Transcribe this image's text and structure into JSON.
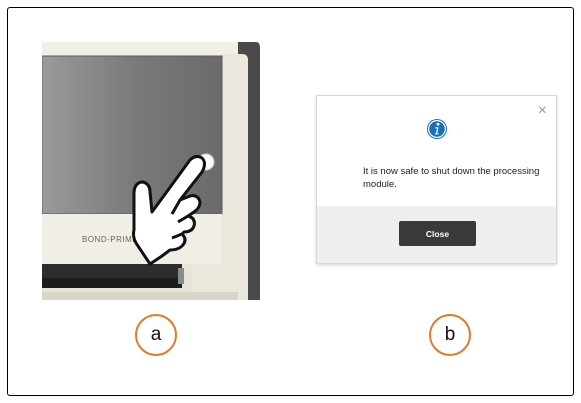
{
  "device": {
    "brand_label": "BOND-PRIME"
  },
  "dialog": {
    "close_glyph": "×",
    "message": "It is now safe to shut down the processing module.",
    "close_button_label": "Close",
    "accent_color": "#1a6fb5"
  },
  "callouts": {
    "a": "a",
    "b": "b",
    "color": "#e07b2c"
  },
  "icons": [
    "info-icon",
    "close-icon",
    "hand-pointer-icon",
    "power-button-icon"
  ]
}
